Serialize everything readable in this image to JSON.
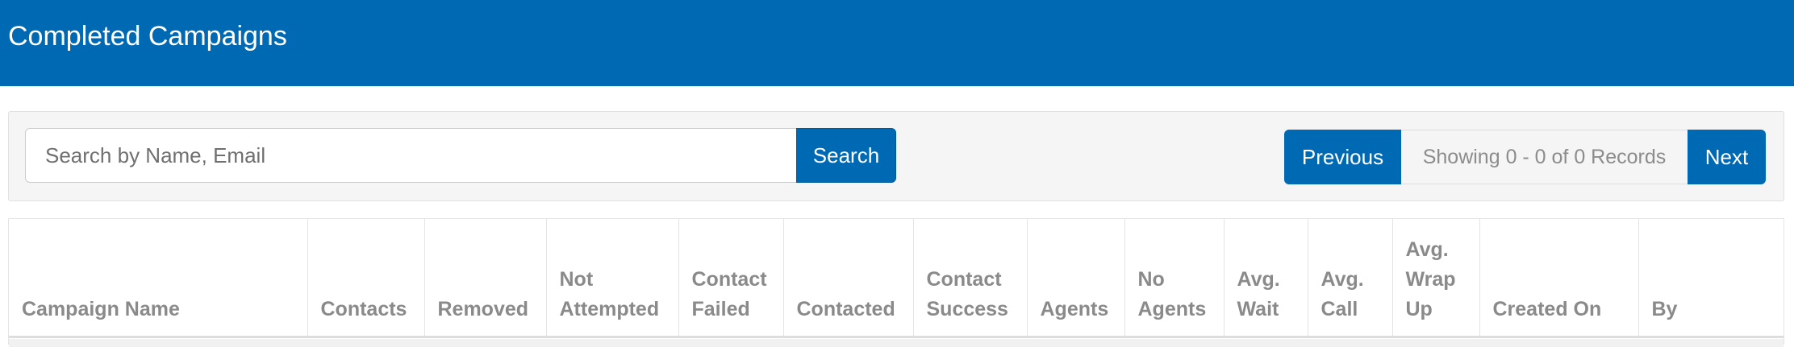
{
  "header": {
    "title": "Completed Campaigns"
  },
  "search": {
    "placeholder": "Search by Name, Email",
    "value": "",
    "button_label": "Search"
  },
  "pagination": {
    "previous_label": "Previous",
    "info": "Showing 0 - 0 of 0 Records",
    "next_label": "Next"
  },
  "table": {
    "columns": [
      "Campaign Name",
      "Contacts",
      "Removed",
      "Not Attempted",
      "Contact Failed",
      "Contacted",
      "Contact Success",
      "Agents",
      "No Agents",
      "Avg. Wait",
      "Avg. Call",
      "Avg. Wrap Up",
      "Created On",
      "By"
    ],
    "rows": []
  },
  "colors": {
    "brand": "#0069b4",
    "toolbar_bg": "#f5f5f5",
    "header_text": "#8a8a8a"
  }
}
